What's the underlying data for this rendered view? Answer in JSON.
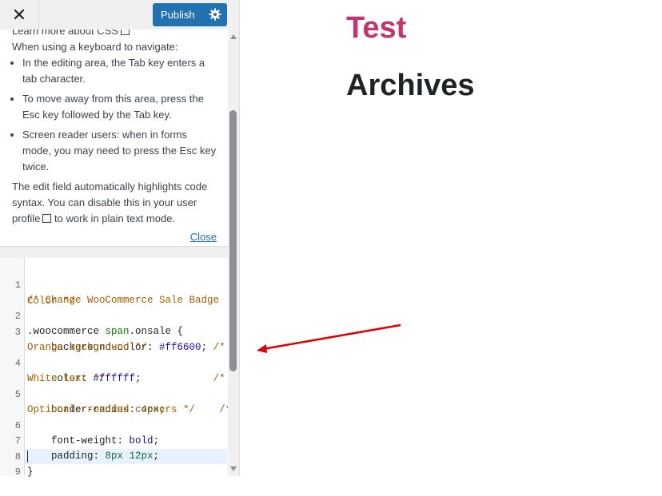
{
  "topbar": {
    "close_icon": "close-icon",
    "publish_label": "Publish",
    "gear_icon": "gear-icon"
  },
  "help": {
    "learn_more": "Learn more about CSS",
    "keyboard_intro": "When using a keyboard to navigate:",
    "bullets": [
      "In the editing area, the Tab key enters a tab character.",
      "To move away from this area, press the Esc key followed by the Tab key.",
      "Screen reader users: when in forms mode, you may need to press the Esc key twice."
    ],
    "highlight_text_1": "The edit field automatically highlights code syntax. You can disable this in your user",
    "highlight_link": "profile",
    "highlight_text_2": "to work in plain text mode.",
    "close_link": "Close"
  },
  "editor": {
    "line_numbers": [
      "1",
      "2",
      "3",
      "4",
      "5",
      "6",
      "7",
      "8",
      "9"
    ],
    "line1": "/* Change WooCommerce Sale Badge",
    "line1b": "Color */",
    "line2_selector": ".woocommerce",
    "line2_tag": "span",
    "line2_class": ".onsale {",
    "line3_prop": "    background-color:",
    "line3_val": "#ff6600",
    "line3_semi": ";",
    "line3_comment": "/*",
    "line3b": "Orange background */",
    "line4_prop": "    color:",
    "line4_val": "#ffffff",
    "line4_semi": ";",
    "line4_comment": "/*",
    "line4b": "White text */",
    "line5_prop": "    border-radius:",
    "line5_val": "4px",
    "line5_semi": ";",
    "line5_comment": "/*",
    "line5b": "Optional: rounded corners */",
    "line6_prop": "    font-weight:",
    "line6_val": "bold",
    "line6_semi": ";",
    "line7_prop": "    padding:",
    "line7_val": "8px 12px",
    "line7_semi": ";",
    "line8": "}"
  },
  "preview": {
    "site_title": "Test",
    "page_title": "Archives"
  },
  "colors": {
    "accent": "#2271b1",
    "site_title": "#c0366f",
    "arrow": "#e00000"
  }
}
